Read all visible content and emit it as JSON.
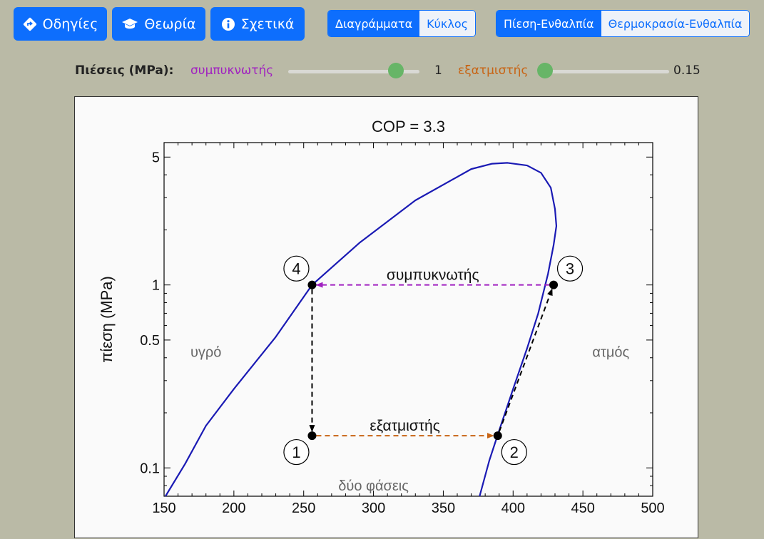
{
  "toolbar": {
    "buttons": [
      {
        "label": "Οδηγίες",
        "icon": "diamond-turn-icon"
      },
      {
        "label": "Θεωρία",
        "icon": "graduation-cap-icon"
      },
      {
        "label": "Σχετικά",
        "icon": "info-circle-icon"
      }
    ],
    "view_group": {
      "options": [
        "Διαγράμματα",
        "Κύκλος"
      ],
      "selected": "Διαγράμματα"
    },
    "diagram_group": {
      "options": [
        "Πίεση-Ενθαλπία",
        "Θερμοκρασία-Ενθαλπία"
      ],
      "selected": "Πίεση-Ενθαλπία"
    }
  },
  "pressures": {
    "label": "Πιέσεις (MPa):",
    "condenser": {
      "label": "συμπυκνωτής",
      "value": "1",
      "level": 0.82,
      "color": "#a020c0"
    },
    "evaporator": {
      "label": "εξατμιστής",
      "value": "0.15",
      "level": 0.0,
      "color": "#c86414"
    }
  },
  "chart_data": {
    "type": "line",
    "title": "COP = 3.3",
    "ylabel": "πίεση (MPa)",
    "xlim": [
      150,
      500
    ],
    "ylim": [
      0.07,
      6
    ],
    "yscale": "log",
    "xticks": [
      150,
      200,
      250,
      300,
      350,
      400,
      450,
      500
    ],
    "yticks": [
      {
        "v": 5,
        "t": "5"
      },
      {
        "v": 1,
        "t": "1"
      },
      {
        "v": 0.5,
        "t": "0.5"
      },
      {
        "v": 0.1,
        "t": "0.1"
      }
    ],
    "dome": {
      "color": "#1a1ab4",
      "x": [
        151,
        165,
        180,
        200,
        230,
        256,
        290,
        330,
        370,
        385,
        396,
        410,
        420,
        427,
        430,
        431,
        429,
        425,
        418,
        410,
        400,
        390,
        383,
        376
      ],
      "y": [
        0.07,
        0.105,
        0.17,
        0.27,
        0.52,
        1.0,
        1.7,
        2.9,
        4.3,
        4.6,
        4.65,
        4.5,
        4.1,
        3.4,
        2.6,
        2.1,
        1.65,
        1.15,
        0.7,
        0.45,
        0.27,
        0.16,
        0.11,
        0.07
      ]
    },
    "points": [
      {
        "n": "1",
        "x": 256,
        "y": 0.15
      },
      {
        "n": "2",
        "x": 389,
        "y": 0.15
      },
      {
        "n": "3",
        "x": 429,
        "y": 1.0
      },
      {
        "n": "4",
        "x": 256,
        "y": 1.0
      }
    ],
    "processes": [
      {
        "from": "3",
        "to": "4",
        "color": "#a020c0",
        "label": "συμπυκνωτής"
      },
      {
        "from": "4",
        "to": "1",
        "color": "#000000",
        "label": ""
      },
      {
        "from": "1",
        "to": "2",
        "color": "#c86414",
        "label": "εξατμιστής"
      },
      {
        "from": "2",
        "to": "3",
        "color": "#000000",
        "label": ""
      }
    ],
    "regions": [
      {
        "text": "υγρό",
        "x": 180,
        "y": 0.43
      },
      {
        "text": "ατμός",
        "x": 470,
        "y": 0.43
      },
      {
        "text": "δύο φάσεις",
        "x": 300,
        "y": 0.08
      }
    ]
  }
}
